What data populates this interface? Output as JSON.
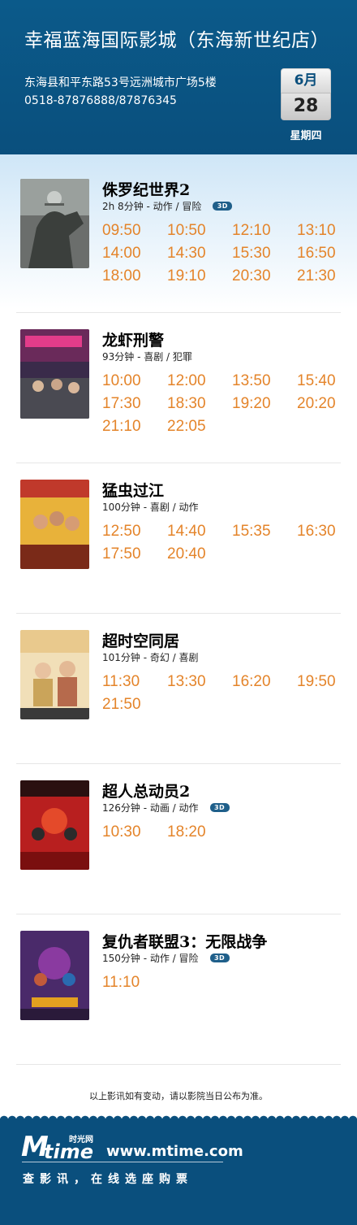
{
  "cinema": {
    "name": "幸福蓝海国际影城（东海新世纪店）",
    "address": "东海县和平东路53号远洲城市广场5楼",
    "phone": "0518-87876888/87876345"
  },
  "date": {
    "month": "6月",
    "day": "28",
    "weekday": "星期四"
  },
  "movies": [
    {
      "title": "侏罗纪世界2",
      "meta": "2h 8分钟 - 动作 / 冒险",
      "is3d": true,
      "badge": "3D",
      "times": [
        "09:50",
        "10:50",
        "12:10",
        "13:10",
        "14:00",
        "14:30",
        "15:30",
        "16:50",
        "18:00",
        "19:10",
        "20:30",
        "21:30"
      ]
    },
    {
      "title": "龙虾刑警",
      "meta": "93分钟 - 喜剧 / 犯罪",
      "is3d": false,
      "times": [
        "10:00",
        "12:00",
        "13:50",
        "15:40",
        "17:30",
        "18:30",
        "19:20",
        "20:20",
        "21:10",
        "22:05"
      ]
    },
    {
      "title": "猛虫过江",
      "meta": "100分钟 - 喜剧 / 动作",
      "is3d": false,
      "times": [
        "12:50",
        "14:40",
        "15:35",
        "16:30",
        "17:50",
        "20:40"
      ]
    },
    {
      "title": "超时空同居",
      "meta": "101分钟 - 奇幻 / 喜剧",
      "is3d": false,
      "times": [
        "11:30",
        "13:30",
        "16:20",
        "19:50",
        "21:50"
      ]
    },
    {
      "title": "超人总动员2",
      "meta": "126分钟 - 动画 / 动作",
      "is3d": true,
      "badge": "3D",
      "times": [
        "10:30",
        "18:20"
      ]
    },
    {
      "title": "复仇者联盟3：无限战争",
      "meta": "150分钟 - 动作 / 冒险",
      "is3d": true,
      "badge": "3D",
      "times": [
        "11:10"
      ]
    }
  ],
  "notice": "以上影讯如有变动，请以影院当日公布为准。",
  "footer": {
    "logo_m": "M",
    "logo_time": "time",
    "logo_cn": "时光网",
    "url": "www.mtime.com",
    "slogan": "查影讯，在线选座购票"
  },
  "colors": {
    "header": "#0a4f7d",
    "time": "#e4842a",
    "badge": "#1f5f8a"
  },
  "icons": [
    "calendar-icon",
    "3d-badge-icon",
    "mtime-logo"
  ]
}
